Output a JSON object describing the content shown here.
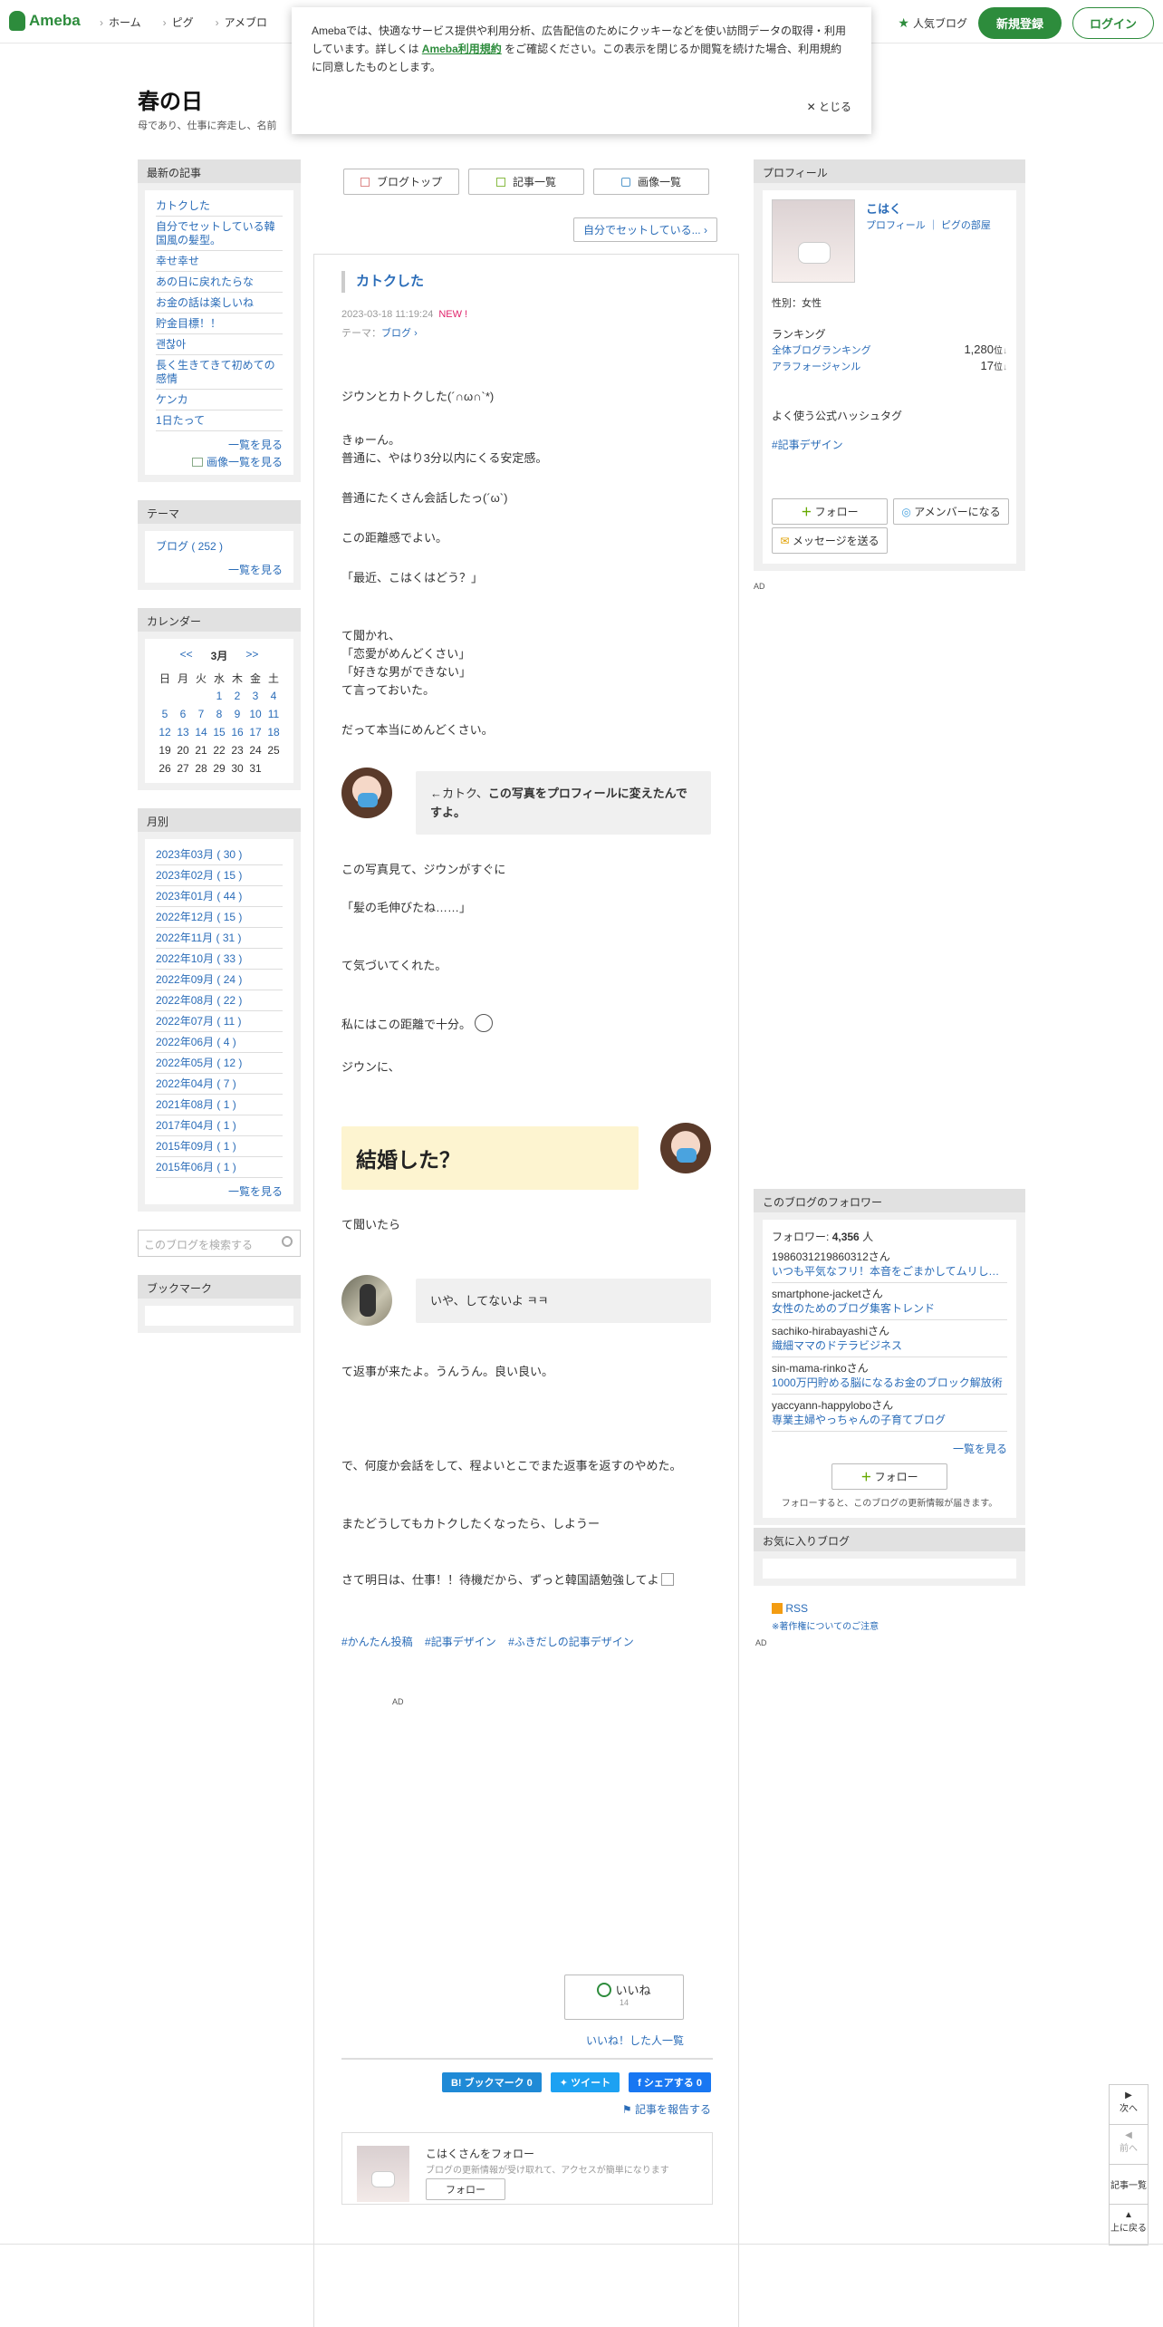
{
  "header": {
    "logo": "Ameba",
    "nav": [
      "ホーム",
      "ピグ",
      "アメブロ"
    ],
    "popular_blog": "人気ブログ",
    "register": "新規登録",
    "login": "ログイン"
  },
  "cookie": {
    "text_before": "Amebaでは、快適なサービス提供や利用分析、広告配信のためにクッキーなどを使い訪問データの取得・利用しています。詳しくは ",
    "link": "Ameba利用規約",
    "text_after": " をご確認ください。この表示を閉じるか閲覧を続けた場合、利用規約に同意したものとします。",
    "close": "とじる"
  },
  "blog": {
    "title": "春の日",
    "subtitle": "母であり、仕事に奔走し、名前"
  },
  "left": {
    "recent_head": "最新の記事",
    "recent": [
      "カトクした",
      "自分でセットしている韓国風の髪型。",
      "幸せ幸せ",
      "あの日に戻れたらな",
      "お金の話は楽しいね",
      "貯金目標！！",
      "괜찮아",
      "長く生きてきて初めての感情",
      "ケンカ",
      "1日たって"
    ],
    "more": "一覧を見る",
    "images": "画像一覧を見る",
    "theme_head": "テーマ",
    "theme_item": "ブログ ( 252 )",
    "calendar_head": "カレンダー",
    "cal_prev": "<<",
    "cal_month": "3月",
    "cal_next": ">>",
    "weekdays": [
      "日",
      "月",
      "火",
      "水",
      "木",
      "金",
      "土"
    ],
    "cal_rows": [
      [
        "",
        "",
        "",
        "1",
        "2",
        "3",
        "4"
      ],
      [
        "5",
        "6",
        "7",
        "8",
        "9",
        "10",
        "11"
      ],
      [
        "12",
        "13",
        "14",
        "15",
        "16",
        "17",
        "18"
      ],
      [
        "19",
        "20",
        "21",
        "22",
        "23",
        "24",
        "25"
      ],
      [
        "26",
        "27",
        "28",
        "29",
        "30",
        "31",
        ""
      ]
    ],
    "monthly_head": "月別",
    "monthly": [
      "2023年03月 ( 30 )",
      "2023年02月 ( 15 )",
      "2023年01月 ( 44 )",
      "2022年12月 ( 15 )",
      "2022年11月 ( 31 )",
      "2022年10月 ( 33 )",
      "2022年09月 ( 24 )",
      "2022年08月 ( 22 )",
      "2022年07月 ( 11 )",
      "2022年06月 ( 4 )",
      "2022年05月 ( 12 )",
      "2022年04月 ( 7 )",
      "2021年08月 ( 1 )",
      "2017年04月 ( 1 )",
      "2015年09月 ( 1 )",
      "2015年06月 ( 1 )"
    ],
    "search_placeholder": "このブログを検索する",
    "bookmark_head": "ブックマーク"
  },
  "main": {
    "btn_top": "ブログトップ",
    "btn_list": "記事一覧",
    "btn_images": "画像一覧",
    "next_article": "自分でセットしている...",
    "title": "カトクした",
    "date": "2023-03-18 11:19:24",
    "new": "NEW !",
    "theme_label": "テーマ：",
    "theme": "ブログ",
    "p1": "ジウンとカトクした(´∩ω∩`*)",
    "p2": "きゅーん。",
    "p3": "普通に、やはり3分以内にくる安定感。",
    "p4": "普通にたくさん会話したっ(´ω`)",
    "p5": "この距離感でよい。",
    "p6": "「最近、こはくはどう？」",
    "p7": "て聞かれ、",
    "p8": "「恋愛がめんどくさい」",
    "p9": "「好きな男ができない」",
    "p10": "て言っておいた。",
    "p11": "だって本当にめんどくさい。",
    "bubble1a": "←カトク、",
    "bubble1b": "この写真をプロフィールに変えたんですよ。",
    "p12": "この写真見て、ジウンがすぐに",
    "p13": "「髪の毛伸びたね……」",
    "p14": "て気づいてくれた。",
    "p15": "私にはこの距離で十分。",
    "p16": "ジウンに、",
    "yellow": "結婚した？",
    "p17": "て聞いたら",
    "bubble2": "いや、してないよ ㅋㅋ",
    "p18": "て返事が来たよ。うんうん。良い良い。",
    "p19": "で、何度か会話をして、程よいとこでまた返事を返すのやめた。",
    "p20": "またどうしてもカトクしたくなったら、しようー",
    "p21": "さて明日は、仕事！！待機だから、ずっと韓国語勉強してよ",
    "tags": [
      "#かんたん投稿",
      "#記事デザイン",
      "#ふきだしの記事デザイン"
    ],
    "ad": "AD",
    "like": "いいね",
    "like_count": "14",
    "like_list": "いいね！した人一覧",
    "hatena": "B! ブックマーク  0",
    "tweet": "ツイート",
    "share": "シェアする 0",
    "report": "記事を報告する",
    "follow_title": "こはくさんをフォロー",
    "follow_desc": "ブログの更新情報が受け取れて、アクセスが簡単になります",
    "follow_btn": "フォロー"
  },
  "right": {
    "profile_head": "プロフィール",
    "name": "こはく",
    "profile_link": "プロフィール",
    "pig_link": "ピグの部屋",
    "gender": "性別：女性",
    "ranking": "ランキング",
    "rank1_label": "全体ブログランキング",
    "rank1_val": "1,280",
    "rank2_label": "アラフォージャンル",
    "rank2_val": "17",
    "rank_unit": "位",
    "hashtag_head": "よく使う公式ハッシュタグ",
    "hashtag": "#記事デザイン",
    "follow": "フォロー",
    "member": "アメンバーになる",
    "message": "メッセージを送る",
    "ad": "AD",
    "followers_head": "このブログのフォロワー",
    "followers_label": "フォロワー:",
    "followers_count": "4,356",
    "followers_unit": "人",
    "followers": [
      {
        "user": "1986031219860312さん",
        "blog": "いつも平気なフリ！本音をごまかしてムリしてる人へ"
      },
      {
        "user": "smartphone-jacketさん",
        "blog": "女性のためのブログ集客トレンド"
      },
      {
        "user": "sachiko-hirabayashiさん",
        "blog": "繊細ママのドテラビジネス"
      },
      {
        "user": "sin-mama-rinkoさん",
        "blog": "1000万円貯める脳になるお金のブロック解放術"
      },
      {
        "user": "yaccyann-happyloboさん",
        "blog": "専業主婦やっちゃんの子育てブログ"
      }
    ],
    "followers_more": "一覧を見る",
    "follow_btn2": "フォロー",
    "follow_note": "フォローすると、このブログの更新情報が届きます。",
    "fav_head": "お気に入りブログ",
    "rss": "RSS",
    "copyright": "※著作権についてのご注意",
    "ad2": "AD"
  },
  "pager": {
    "next": "次へ",
    "prev": "前へ",
    "list": "記事一覧",
    "top": "上に戻る"
  }
}
